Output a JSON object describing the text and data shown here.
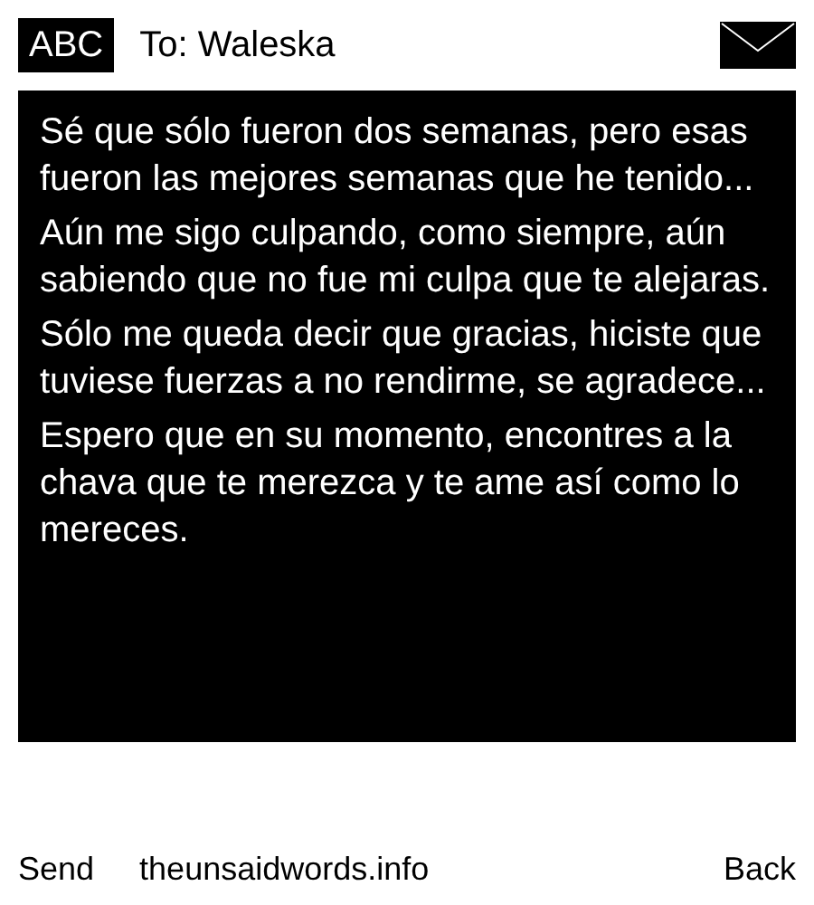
{
  "header": {
    "input_mode": "ABC",
    "recipient": "To: Waleska"
  },
  "message": {
    "paragraphs": [
      "Sé que sólo fueron dos semanas, pero esas fueron las mejores semanas que he tenido...",
      "Aún me sigo culpando, como siempre, aún sabiendo que no fue mi culpa que te alejaras.",
      "Sólo me queda decir que gracias, hiciste que tuviese fuerzas a no rendirme, se agradece...",
      "Espero que en su momento, encontres a la chava que te merezca y te ame así como lo mereces."
    ]
  },
  "softkeys": {
    "left": "Send",
    "center": "theunsaidwords.info",
    "right": "Back"
  }
}
